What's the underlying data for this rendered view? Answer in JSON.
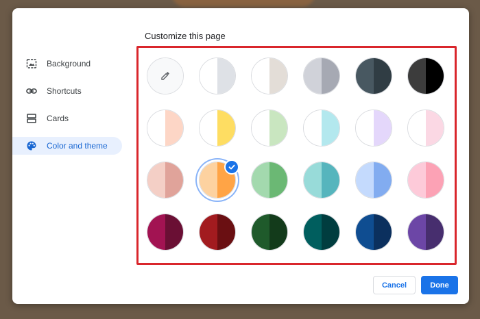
{
  "dialog": {
    "title": "Customize this page"
  },
  "sidebar": {
    "items": [
      {
        "label": "Background",
        "icon": "image-icon",
        "active": false
      },
      {
        "label": "Shortcuts",
        "icon": "link-icon",
        "active": false
      },
      {
        "label": "Cards",
        "icon": "cards-icon",
        "active": false
      },
      {
        "label": "Color and theme",
        "icon": "palette-icon",
        "active": true
      }
    ]
  },
  "swatches": [
    {
      "left": "#f8f9fa",
      "right": "#f8f9fa",
      "icon": "eyedropper-icon"
    },
    {
      "left": "#ffffff",
      "right": "#dee1e6"
    },
    {
      "left": "#ffffff",
      "right": "#e3ddd7"
    },
    {
      "left": "#d0d2d9",
      "right": "#a6a9b3"
    },
    {
      "left": "#485861",
      "right": "#303d44"
    },
    {
      "left": "#3c3c3c",
      "right": "#000000"
    },
    {
      "left": "#ffffff",
      "right": "#fdd6c6"
    },
    {
      "left": "#ffffff",
      "right": "#fedd62"
    },
    {
      "left": "#ffffff",
      "right": "#c9e6c0"
    },
    {
      "left": "#ffffff",
      "right": "#b3e8ee"
    },
    {
      "left": "#ffffff",
      "right": "#e4d7fb"
    },
    {
      "left": "#ffffff",
      "right": "#fbd8e4"
    },
    {
      "left": "#f4cfc6",
      "right": "#e0a39a"
    },
    {
      "left": "#fdd2a0",
      "right": "#ffa446",
      "selected": true
    },
    {
      "left": "#a3d9ae",
      "right": "#6bb874"
    },
    {
      "left": "#98dbd9",
      "right": "#56b5bd"
    },
    {
      "left": "#c4dafd",
      "right": "#82acf0"
    },
    {
      "left": "#fdcad9",
      "right": "#fca2b5"
    },
    {
      "left": "#a21352",
      "right": "#6a0f34"
    },
    {
      "left": "#a21b1f",
      "right": "#6a0f12"
    },
    {
      "left": "#1f5a2b",
      "right": "#133b1b"
    },
    {
      "left": "#005e5e",
      "right": "#003d3f"
    },
    {
      "left": "#0f4d91",
      "right": "#0b305e"
    },
    {
      "left": "#6c46a6",
      "right": "#472e6e"
    }
  ],
  "footer": {
    "cancel_label": "Cancel",
    "done_label": "Done"
  }
}
